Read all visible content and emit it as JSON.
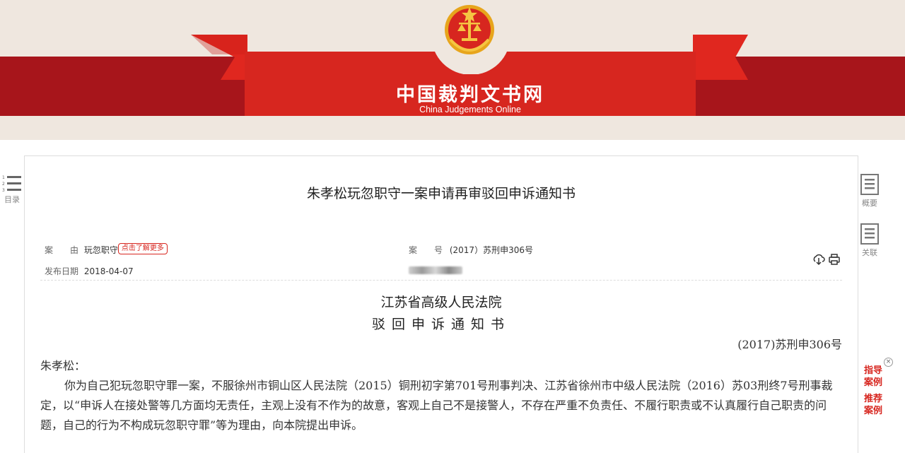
{
  "header": {
    "site_title": "中国裁判文书网",
    "site_subtitle": "China Judgements Online"
  },
  "document": {
    "title": "朱孝松玩忽职守一案申请再审驳回申诉通知书",
    "cause_label": "案　　由",
    "cause_value": "玩忽职守",
    "cause_tag": "点击了解更多",
    "case_no_label": "案　　号",
    "case_no_value": "(2017）苏刑申306号",
    "pub_date_label": "发布日期",
    "pub_date_value": "2018-04-07",
    "court_name": "江苏省高级人民法院",
    "doc_type": "驳回申诉通知书",
    "doc_number": "(2017)苏刑申306号",
    "addressee": "朱孝松：",
    "paragraph1": "你为自己犯玩忽职守罪一案，不服徐州市铜山区人民法院（2015）铜刑初字第701号刑事判决、江苏省徐州市中级人民法院（2016）苏03刑终7号刑事裁定，以“申诉人在接处警等几方面均无责任，主观上没有不作为的故意，客观上自己不是接警人，不存在严重不负责任、不履行职责或不认真履行自己职责的问题，自己的行为不构成玩忽职守罪”等为理由，向本院提出申诉。"
  },
  "sidebar_left": {
    "toc_label": "目录"
  },
  "sidebar_right": {
    "summary_label": "概要",
    "related_label": "关联",
    "guide_label_1": "指导",
    "guide_label_2": "案例",
    "recommend_label_1": "推荐",
    "recommend_label_2": "案例",
    "close_symbol": "×"
  },
  "icons": {
    "download": "download-icon",
    "print": "print-icon"
  },
  "colors": {
    "brand_red": "#d7261f",
    "dark_red": "#a7151b",
    "header_bg": "#efe7df"
  }
}
